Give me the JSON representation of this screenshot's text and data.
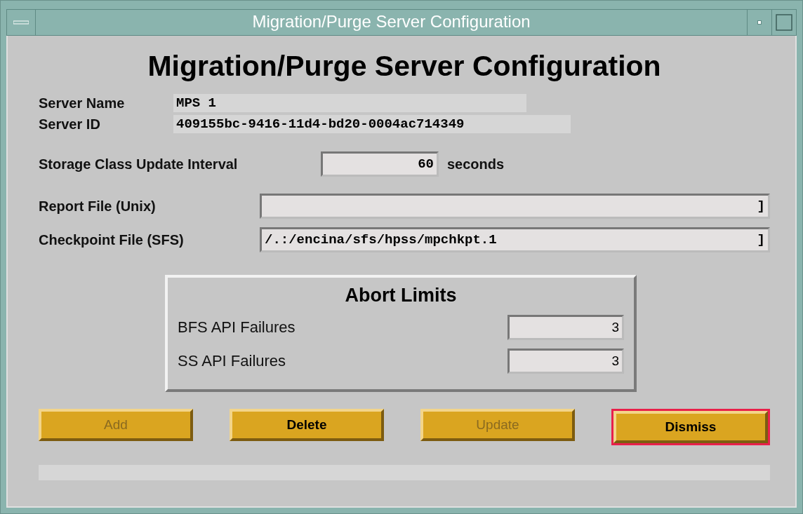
{
  "window": {
    "title": "Migration/Purge Server Configuration"
  },
  "heading": "Migration/Purge Server Configuration",
  "info": [
    {
      "label": "Server Name",
      "value": "MPS 1"
    },
    {
      "label": "Server ID",
      "value": "409155bc-9416-11d4-bd20-0004ac714349"
    }
  ],
  "interval": {
    "label": "Storage Class Update Interval",
    "value": "60",
    "unit": "seconds"
  },
  "files": [
    {
      "label": "Report File (Unix)",
      "end_mark": "]"
    },
    {
      "label": "Checkpoint File (SFS)",
      "value": "/.:/encina/sfs/hpss/mpchkpt.1",
      "end_mark": "]"
    }
  ],
  "abort_limits": {
    "title": "Abort Limits",
    "rows": [
      {
        "label": "BFS API Failures",
        "value": "3"
      },
      {
        "label": "SS API Failures",
        "value": "3"
      }
    ]
  },
  "buttons": [
    {
      "label": "Add",
      "disabled": true,
      "focused": false
    },
    {
      "label": "Delete",
      "disabled": false,
      "focused": false
    },
    {
      "label": "Update",
      "disabled": true,
      "focused": false
    },
    {
      "label": "Dismiss",
      "disabled": false,
      "focused": true
    }
  ]
}
